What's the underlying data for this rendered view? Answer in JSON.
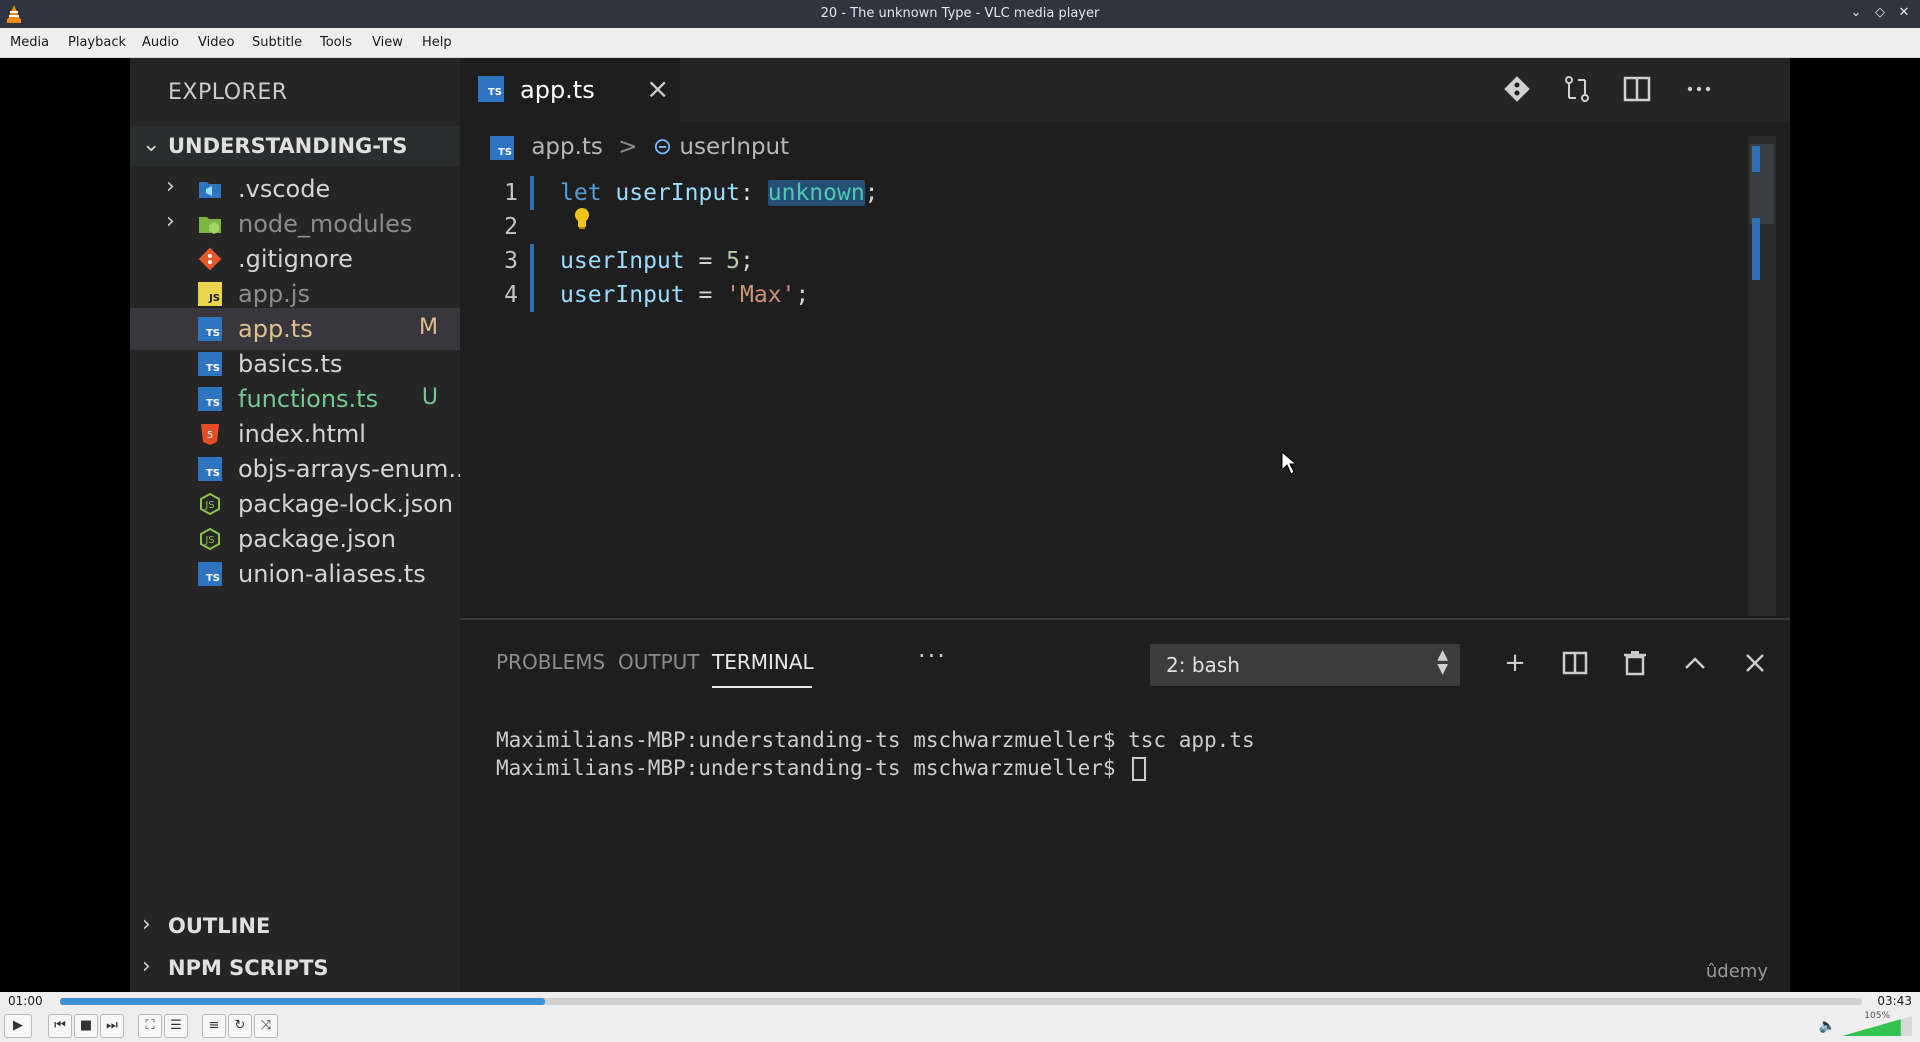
{
  "window": {
    "title": "20 - The unknown Type - VLC media player"
  },
  "menu": [
    "Media",
    "Playback",
    "Audio",
    "Video",
    "Subtitle",
    "Tools",
    "View",
    "Help"
  ],
  "vscode": {
    "sidebar": {
      "title": "EXPLORER",
      "project": "UNDERSTANDING-TS",
      "files": [
        {
          "name": ".vscode",
          "type": "folder",
          "icon": "vscode-folder-icon",
          "color": "#d4d4d4",
          "badge": ""
        },
        {
          "name": "node_modules",
          "type": "folder",
          "icon": "node-folder-icon",
          "color": "#8c8c8c",
          "badge": ""
        },
        {
          "name": ".gitignore",
          "type": "file",
          "icon": "git-icon",
          "color": "#d4d4d4",
          "badge": ""
        },
        {
          "name": "app.js",
          "type": "file",
          "icon": "js-icon",
          "color": "#8c8c8c",
          "badge": ""
        },
        {
          "name": "app.ts",
          "type": "file",
          "icon": "ts-icon",
          "color": "#e2c08d",
          "badge": "M",
          "selected": true
        },
        {
          "name": "basics.ts",
          "type": "file",
          "icon": "ts-icon",
          "color": "#d4d4d4",
          "badge": ""
        },
        {
          "name": "functions.ts",
          "type": "file",
          "icon": "ts-icon",
          "color": "#73c991",
          "badge": "U"
        },
        {
          "name": "index.html",
          "type": "file",
          "icon": "html-icon",
          "color": "#d4d4d4",
          "badge": ""
        },
        {
          "name": "objs-arrays-enum...",
          "type": "file",
          "icon": "ts-icon",
          "color": "#d4d4d4",
          "badge": ""
        },
        {
          "name": "package-lock.json",
          "type": "file",
          "icon": "node-icon",
          "color": "#d4d4d4",
          "badge": ""
        },
        {
          "name": "package.json",
          "type": "file",
          "icon": "node-icon",
          "color": "#d4d4d4",
          "badge": ""
        },
        {
          "name": "union-aliases.ts",
          "type": "file",
          "icon": "ts-icon",
          "color": "#d4d4d4",
          "badge": ""
        }
      ],
      "outline": "OUTLINE",
      "npm_scripts": "NPM SCRIPTS"
    },
    "tab": {
      "label": "app.ts",
      "icon_text": "TS"
    },
    "breadcrumb": {
      "file": "app.ts",
      "separator": ">",
      "symbol": "userInput"
    },
    "code": {
      "line_numbers": [
        "1",
        "2",
        "3",
        "4"
      ],
      "line1": {
        "kw": "let",
        "var": "userInput",
        "colon": ": ",
        "type": "unknown",
        "end": ";"
      },
      "line3": {
        "var": "userInput",
        "op": " = ",
        "value": "5",
        "end": ";"
      },
      "line4": {
        "var": "userInput",
        "op": " = ",
        "value": "'Max'",
        "end": ";"
      }
    },
    "panel": {
      "tabs": [
        "PROBLEMS",
        "OUTPUT",
        "TERMINAL"
      ],
      "active_tab": "TERMINAL",
      "more": "···",
      "terminal_select": "2: bash",
      "terminal_lines": [
        "Maximilians-MBP:understanding-ts mschwarzmueller$ tsc app.ts",
        "Maximilians-MBP:understanding-ts mschwarzmueller$ "
      ],
      "watermark": "ûdemy"
    }
  },
  "player": {
    "elapsed": "01:00",
    "total": "03:43",
    "progress": 0.269,
    "volume": "105%",
    "volume_level": 1.05,
    "accent": "#3d8fd8"
  }
}
